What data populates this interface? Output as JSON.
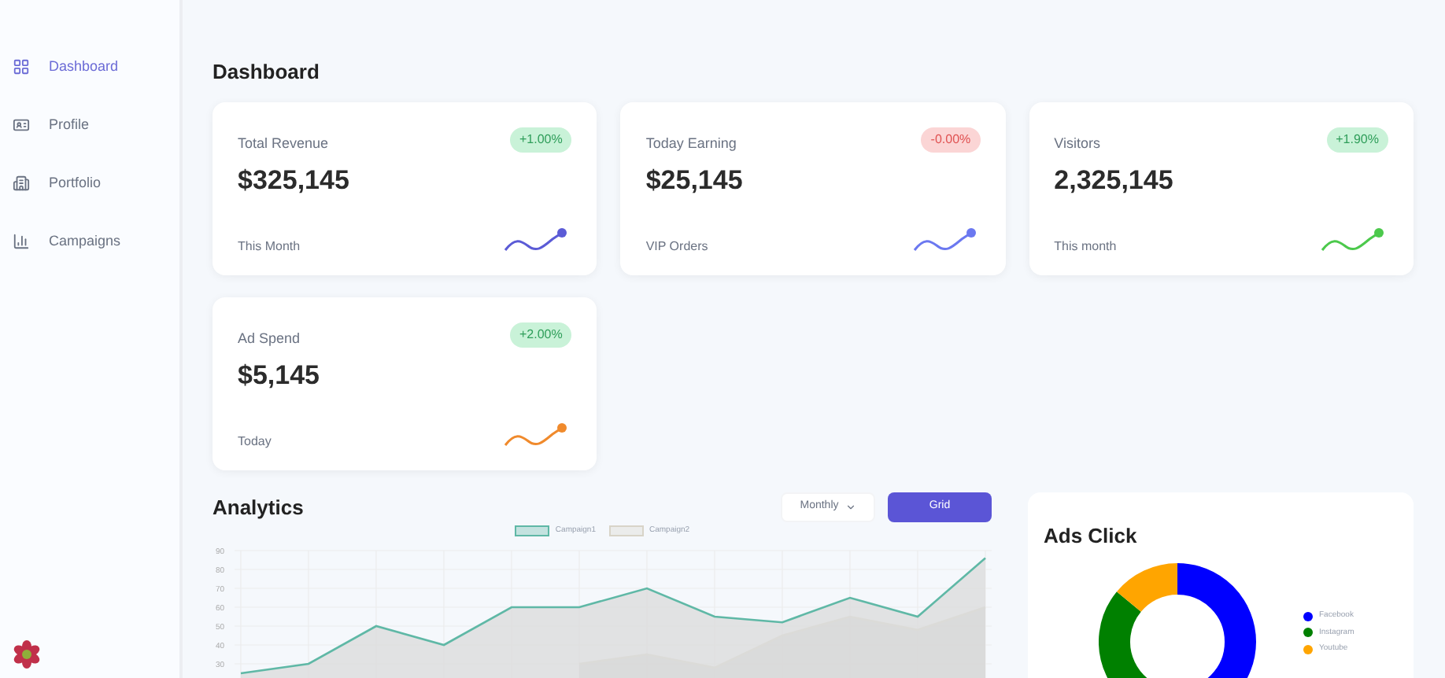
{
  "sidebar": {
    "items": [
      {
        "label": "Dashboard",
        "selected": true
      },
      {
        "label": "Profile",
        "selected": false
      },
      {
        "label": "Portfolio",
        "selected": false
      },
      {
        "label": "Campaigns",
        "selected": false
      }
    ]
  },
  "page_title": "Dashboard",
  "stat_cards": [
    {
      "title": "Total Revenue",
      "value": "$325,145",
      "note": "This Month",
      "change": "+1.00%",
      "negative": false,
      "color": "#5b5bd6"
    },
    {
      "title": "Today Earning",
      "value": "$25,145",
      "note": "VIP Orders",
      "change": "-0.00%",
      "negative": true,
      "color": "#6b78f0"
    },
    {
      "title": "Visitors",
      "value": "2,325,145",
      "note": "This month",
      "change": "+1.90%",
      "negative": false,
      "color": "#4cc94c"
    },
    {
      "title": "Ad Spend",
      "value": "$5,145",
      "note": "Today",
      "change": "+2.00%",
      "negative": false,
      "color": "#f08a2c"
    }
  ],
  "analytics": {
    "title": "Analytics",
    "period": "Monthly",
    "button": "Grid",
    "chart_data": {
      "type": "area",
      "grid": true,
      "yticks": [
        30,
        40,
        50,
        60,
        70,
        80,
        90
      ],
      "ylim": [
        20,
        90
      ],
      "series": [
        {
          "name": "Campaign1",
          "color": "#5fb8a6",
          "values": [
            25,
            30,
            50,
            40,
            60,
            60,
            70,
            55,
            52,
            65,
            55,
            86
          ]
        },
        {
          "name": "Campaign2",
          "color": "#d8d4c8",
          "values": [
            null,
            null,
            null,
            null,
            null,
            30,
            35,
            28,
            45,
            55,
            48,
            60
          ]
        }
      ]
    }
  },
  "ads_click": {
    "title": "Ads Click",
    "legend": [
      {
        "label": "Facebook",
        "color": "#0000ff"
      },
      {
        "label": "Instagram",
        "color": "#008000"
      },
      {
        "label": "Youtube",
        "color": "#ffa500"
      }
    ]
  }
}
